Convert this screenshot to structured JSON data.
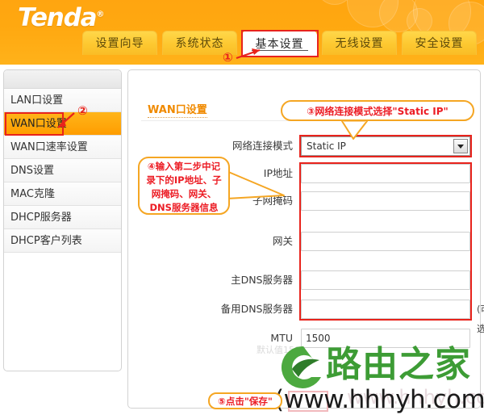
{
  "brand": {
    "name": "Tenda",
    "reg": "®"
  },
  "tabs": [
    {
      "label": "设置向导",
      "active": false
    },
    {
      "label": "系统状态",
      "active": false
    },
    {
      "label": "基本设置",
      "active": true
    },
    {
      "label": "无线设置",
      "active": false
    },
    {
      "label": "安全设置",
      "active": false
    }
  ],
  "sidebar": {
    "items": [
      {
        "label": "LAN口设置",
        "selected": false
      },
      {
        "label": "WAN口设置",
        "selected": true
      },
      {
        "label": "WAN口速率设置",
        "selected": false
      },
      {
        "label": "DNS设置",
        "selected": false
      },
      {
        "label": "MAC克隆",
        "selected": false
      },
      {
        "label": "DHCP服务器",
        "selected": false
      },
      {
        "label": "DHCP客户列表",
        "selected": false
      }
    ]
  },
  "content": {
    "title": "WAN口设置",
    "fields": [
      {
        "label": "网络连接模式",
        "type": "select",
        "value": "Static IP",
        "note": ""
      },
      {
        "label": "IP地址",
        "type": "text",
        "value": "",
        "note": ""
      },
      {
        "label": "子网掩码",
        "type": "text",
        "value": "",
        "note": ""
      },
      {
        "label": "网关",
        "type": "text",
        "value": "",
        "note": ""
      },
      {
        "label": "主DNS服务器",
        "type": "text",
        "value": "",
        "note": ""
      },
      {
        "label": "备用DNS服务器",
        "type": "text",
        "value": "",
        "note": "(可选)"
      },
      {
        "label": "MTU",
        "type": "text",
        "value": "1500",
        "note": ""
      }
    ]
  },
  "callouts": {
    "step3": "③网络连接模式选择\"Static IP\"",
    "step4_lines": [
      "④输入第二步中记",
      "录下的IP地址、子",
      "网掩码、网关、",
      "DNS服务器信息"
    ],
    "step5": "⑤点击\"保存\""
  },
  "markers": {
    "one": "①",
    "two": "②"
  },
  "watermark": {
    "brand_text": "路由之家",
    "url": "(www.hhhyh.com)",
    "faint_hint": "默认值1500",
    "faint_url": "www.hhhyh.com"
  },
  "colors": {
    "header_orange": "#ffa810",
    "tab_yellow": "#fdc830",
    "accent_red": "#e8231c",
    "callout_border": "#f5a623",
    "title_orange": "#f08a00",
    "watermark_green": "#3d9c35",
    "nav_selected": "#ff9d00"
  }
}
